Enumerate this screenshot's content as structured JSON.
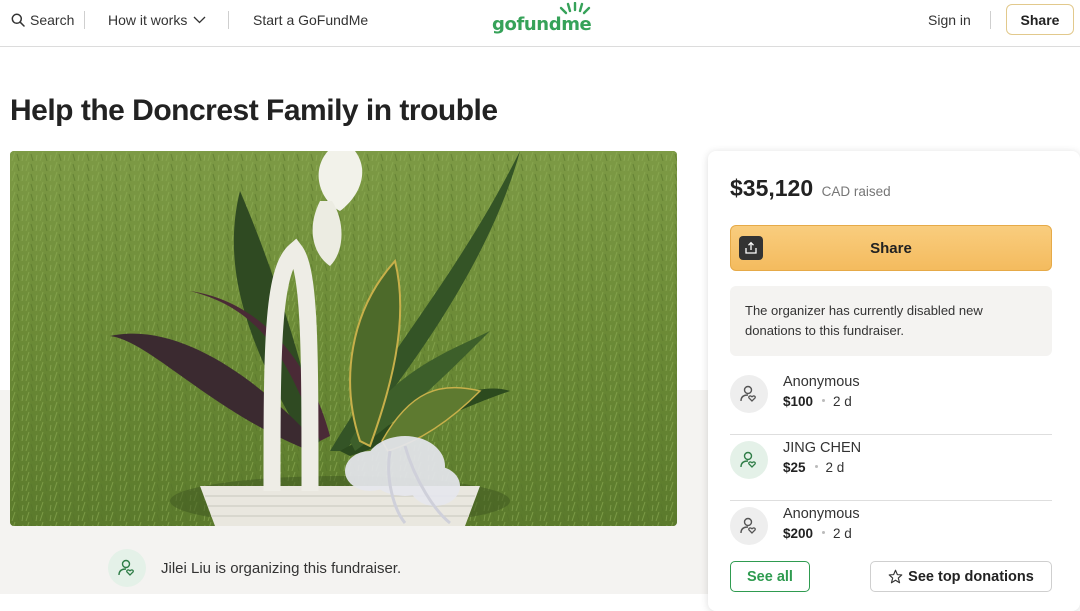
{
  "header": {
    "search_label": "Search",
    "how_label": "How it works",
    "start_label": "Start a GoFundMe",
    "logo_text": "gofundme",
    "signin_label": "Sign in",
    "share_label": "Share"
  },
  "campaign": {
    "title": "Help the Doncrest Family in trouble",
    "hero_image_icon": "plant-basket-photo",
    "organizer_text": "Jilei Liu is organizing this fundraiser."
  },
  "donation_card": {
    "amount_raised": "$35,120",
    "currency_label": "CAD raised",
    "share_label": "Share",
    "notice": "The organizer has currently disabled new donations to this fundraiser.",
    "donations": [
      {
        "name": "Anonymous",
        "amount": "$100",
        "time": "2 d"
      },
      {
        "name": "JING CHEN",
        "amount": "$25",
        "time": "2 d"
      },
      {
        "name": "Anonymous",
        "amount": "$200",
        "time": "2 d"
      }
    ],
    "see_all_label": "See all",
    "see_top_label": "See top donations"
  },
  "colors": {
    "brand_green": "#36a259",
    "share_yellow": "#f7c26a",
    "notice_bg": "#f4f3f1"
  }
}
